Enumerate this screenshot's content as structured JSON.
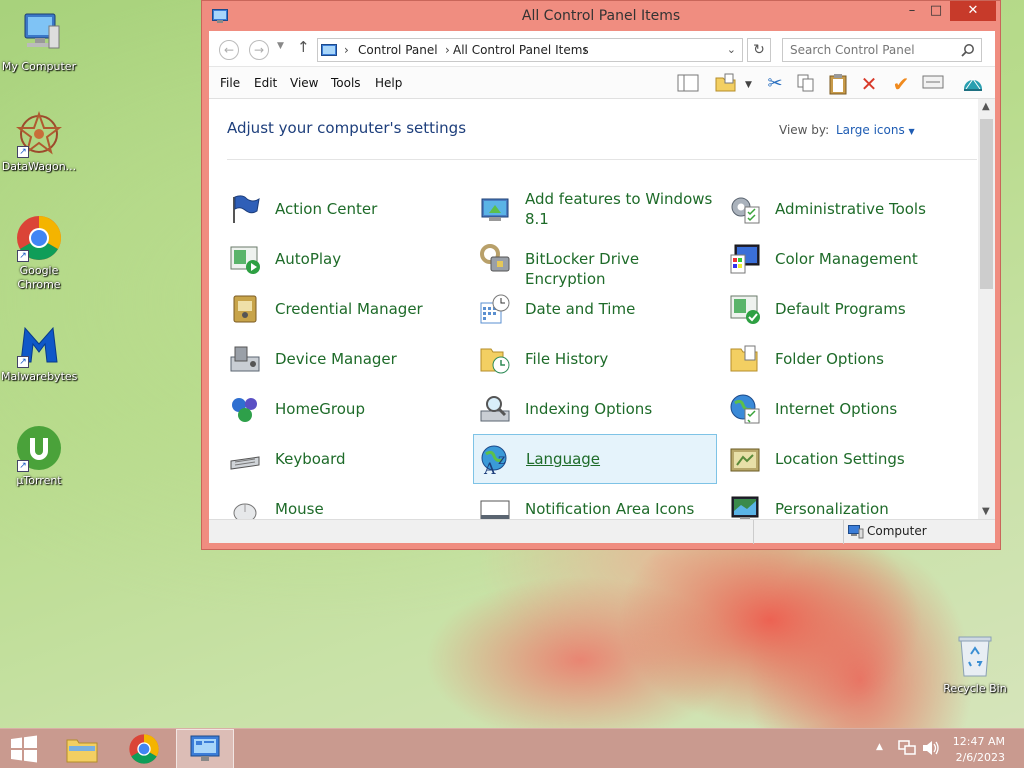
{
  "desktop": {
    "icons": [
      {
        "label": "My Computer"
      },
      {
        "label": "DataWagon..."
      },
      {
        "label": "Google Chrome"
      },
      {
        "label": "Malwarebytes"
      },
      {
        "label": "µTorrent"
      },
      {
        "label": "Recycle Bin"
      }
    ]
  },
  "window": {
    "title": "All Control Panel Items",
    "controls": {
      "minimize": "–",
      "maximize": "□",
      "close": "✕"
    },
    "address": {
      "crumb1": "Control Panel",
      "crumb2": "All Control Panel Items",
      "sep": "›"
    },
    "search": {
      "placeholder": "Search Control Panel"
    },
    "menu": [
      "File",
      "Edit",
      "View",
      "Tools",
      "Help"
    ],
    "heading": "Adjust your computer's settings",
    "view_by_label": "View by:",
    "view_by_value": "Large icons",
    "items": [
      {
        "label": "Action Center",
        "icon": "flag-icon"
      },
      {
        "label": "Add features to Windows 8.1",
        "icon": "add-features-icon"
      },
      {
        "label": "Administrative Tools",
        "icon": "admin-tools-icon"
      },
      {
        "label": "AutoPlay",
        "icon": "autoplay-icon"
      },
      {
        "label": "BitLocker Drive Encryption",
        "icon": "bitlocker-icon"
      },
      {
        "label": "Color Management",
        "icon": "color-management-icon"
      },
      {
        "label": "Credential Manager",
        "icon": "credential-icon"
      },
      {
        "label": "Date and Time",
        "icon": "clock-icon"
      },
      {
        "label": "Default Programs",
        "icon": "default-programs-icon"
      },
      {
        "label": "Device Manager",
        "icon": "device-manager-icon"
      },
      {
        "label": "File History",
        "icon": "file-history-icon"
      },
      {
        "label": "Folder Options",
        "icon": "folder-icon"
      },
      {
        "label": "HomeGroup",
        "icon": "homegroup-icon"
      },
      {
        "label": "Indexing Options",
        "icon": "indexing-icon"
      },
      {
        "label": "Internet Options",
        "icon": "globe-icon"
      },
      {
        "label": "Keyboard",
        "icon": "keyboard-icon"
      },
      {
        "label": "Language",
        "icon": "language-icon"
      },
      {
        "label": "Location Settings",
        "icon": "location-icon"
      },
      {
        "label": "Mouse",
        "icon": "mouse-icon"
      },
      {
        "label": "Notification Area Icons",
        "icon": "notification-icon"
      },
      {
        "label": "Personalization",
        "icon": "personalization-icon"
      }
    ],
    "selected_item": "Language",
    "status": "Computer"
  },
  "taskbar": {
    "time": "12:47 AM",
    "date": "2/6/2023"
  },
  "colors": {
    "title_bar": "#f08d80",
    "close_button": "#c73a2a",
    "link_green": "#1e6b29",
    "heading_blue": "#1e3f7c",
    "taskbar": "#c99a8f"
  }
}
